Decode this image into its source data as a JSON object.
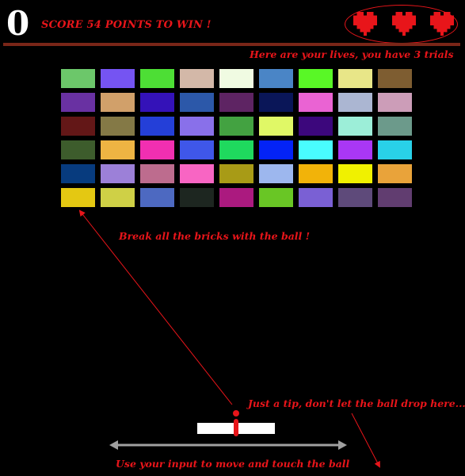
{
  "game": {
    "score": "0",
    "win_message": "SCORE 54 POINTS TO WIN !",
    "lives_count": 3
  },
  "colors": {
    "accent_red": "#e8151a",
    "top_bar": "#7a2618",
    "background": "#000000",
    "paddle": "#ffffff",
    "arrow_gray": "#a0a0a0"
  },
  "annotations": {
    "lives": "Here are your lives, you have 3 trials",
    "break": "Break all the bricks with the ball !",
    "tip": "Just a tip, don't let the ball drop here...",
    "move": "Use your input to move and touch the ball"
  },
  "icons": {
    "life": "heart-icon",
    "move": "double-arrow-icon"
  },
  "bricks": [
    [
      "#6cc76a",
      "#7554f2",
      "#4dde35",
      "#d3b8a8",
      "#f0fbe2",
      "#4a85c6",
      "#59f726",
      "#e8e688",
      "#7e5d31"
    ],
    [
      "#6931a2",
      "#d1a06a",
      "#3412b8",
      "#2c58a9",
      "#5e2463",
      "#0a1658",
      "#ea63d3",
      "#abb6d2",
      "#cc9db8"
    ],
    [
      "#631717",
      "#847946",
      "#243fd8",
      "#8970ea",
      "#43a241",
      "#e0f866",
      "#3c077c",
      "#9ceed8",
      "#6c9a8b"
    ],
    [
      "#3d5c2c",
      "#eeb443",
      "#f12fb1",
      "#3f57e9",
      "#1fd95e",
      "#0423f6",
      "#49fcfe",
      "#a937f5",
      "#29d1e8"
    ],
    [
      "#073b7e",
      "#9c80d8",
      "#bd6c8e",
      "#f865c3",
      "#a89b16",
      "#9db7ee",
      "#f2b309",
      "#f0f100",
      "#e9a33a"
    ],
    [
      "#e4c812",
      "#cfd046",
      "#4d69c1",
      "#1d2620",
      "#ab1a7f",
      "#69c625",
      "#7a60d4",
      "#5e4a7a",
      "#613d70"
    ]
  ]
}
